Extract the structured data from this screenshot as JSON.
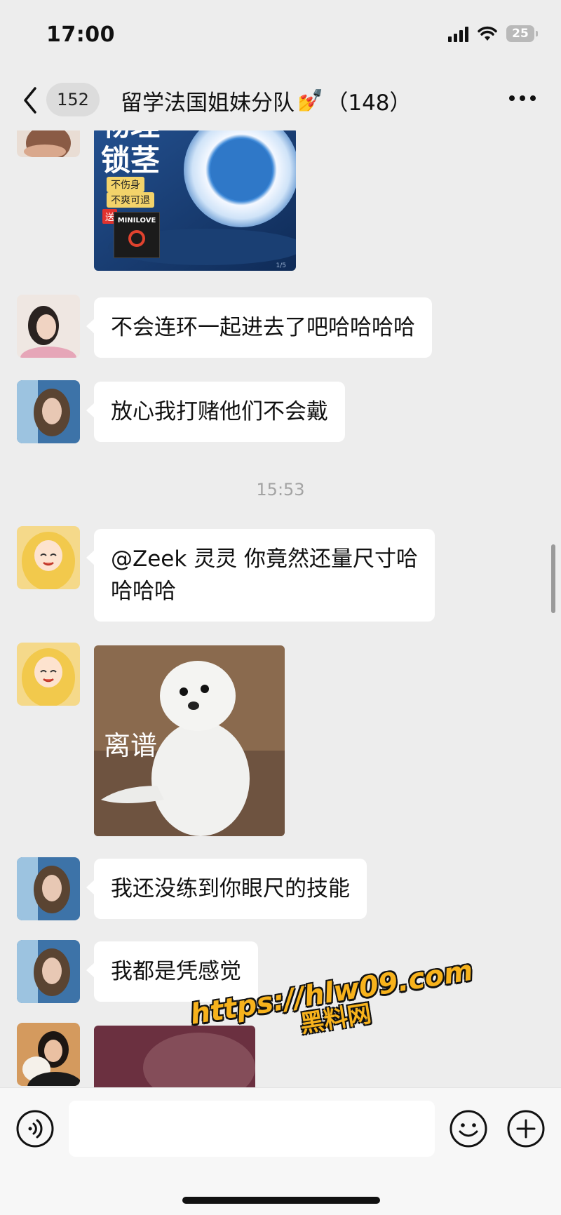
{
  "status_bar": {
    "time": "17:00",
    "battery": "25"
  },
  "header": {
    "unread_count": "152",
    "group_name": "留学法国姐妹分队",
    "title_emoji": "💅",
    "member_count": "（148）"
  },
  "product_image": {
    "headline": "物理锁茎",
    "tag1": "不伤身",
    "tag2": "不爽可退",
    "gift_tag": "送",
    "brand": "MINILOVE",
    "page_marker": "1/5"
  },
  "messages": [
    {
      "text": "不会连环一起进去了吧哈哈哈哈"
    },
    {
      "text": "放心我打赌他们不会戴"
    },
    {
      "text_line1": "@Zeek 灵灵 你竟然还量尺寸哈",
      "text_line2": "哈哈哈"
    },
    {
      "text": "我还没练到你眼尺的技能"
    },
    {
      "text": "我都是凭感觉"
    }
  ],
  "time_divider": "15:53",
  "meme_sticker": {
    "caption": "离谱"
  },
  "watermark": {
    "url": "https://hlw09.com",
    "site": "黑料网"
  },
  "input": {
    "placeholder": ""
  }
}
